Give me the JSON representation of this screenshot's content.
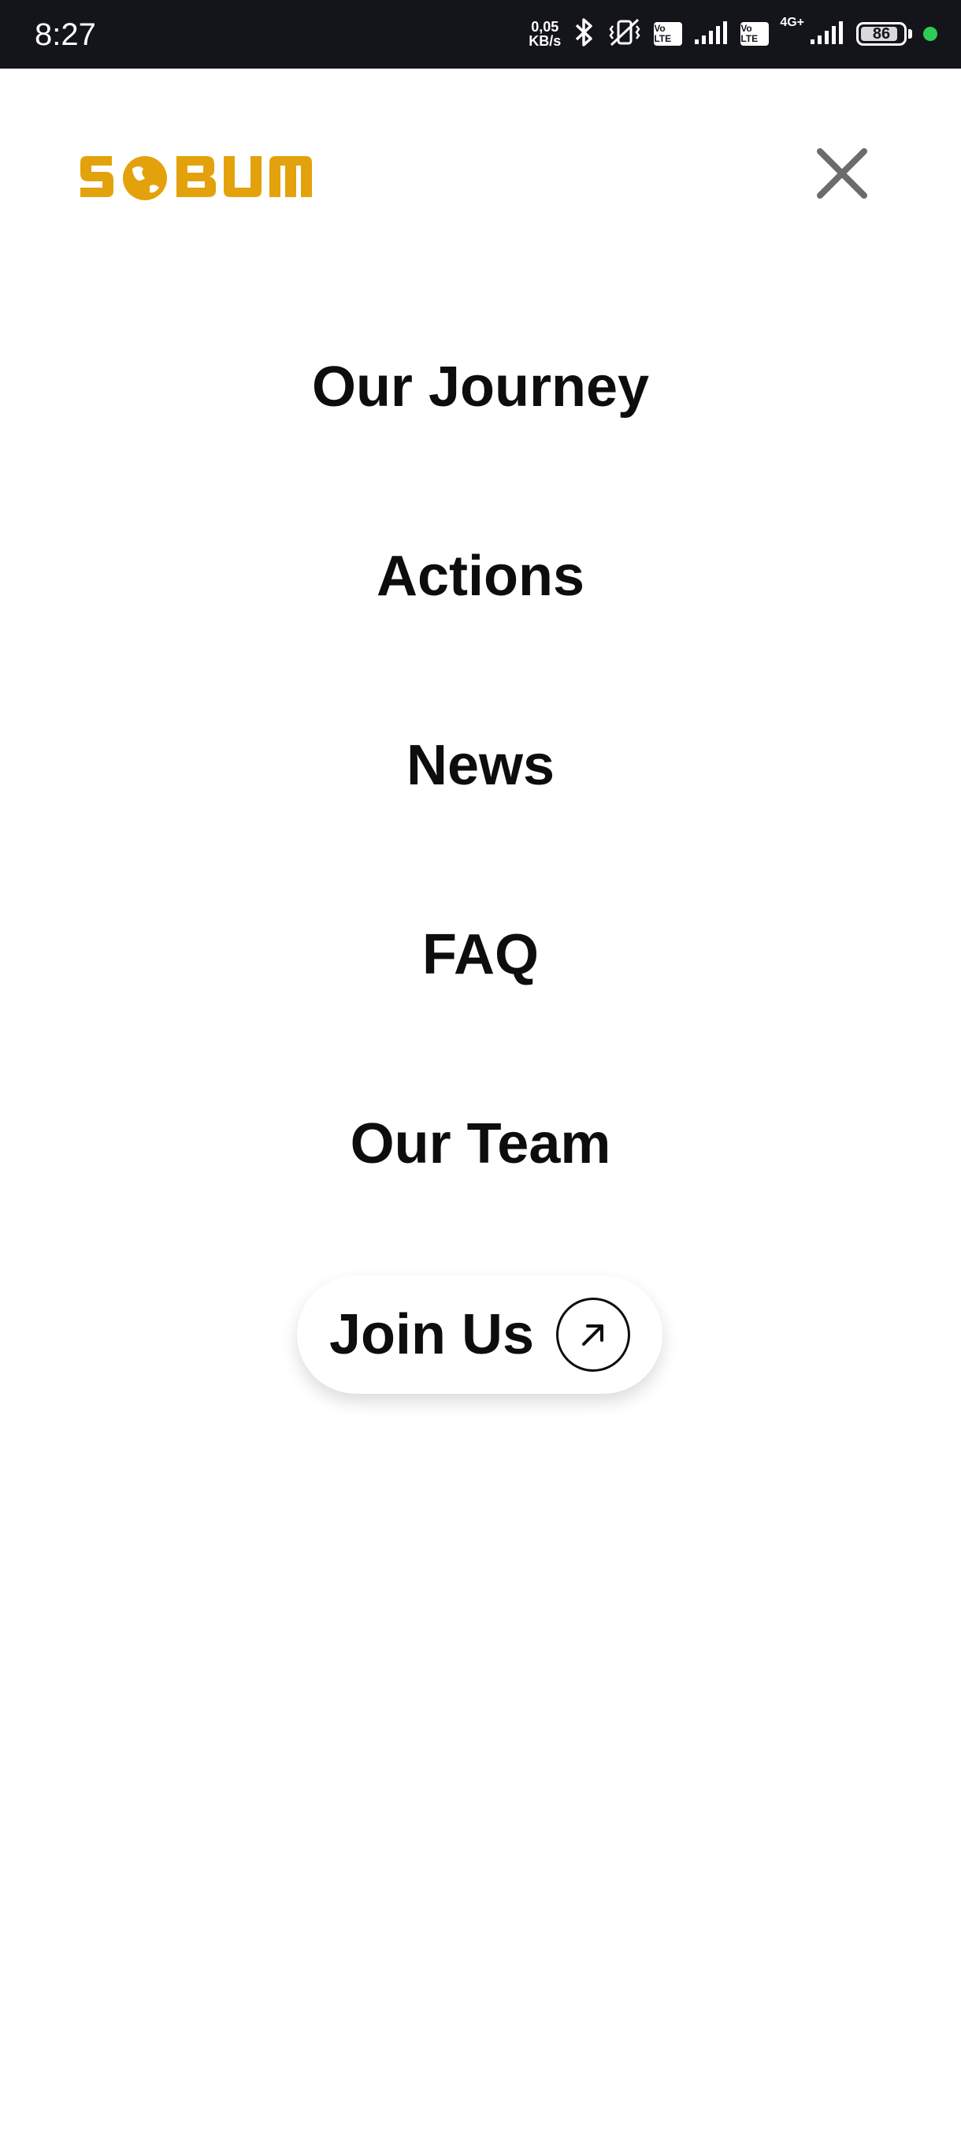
{
  "status_bar": {
    "time": "8:27",
    "net_speed_value": "0,05",
    "net_speed_unit": "KB/s",
    "volte_1": "Vo LTE",
    "volte_2": "Vo LTE",
    "network_type": "4G+",
    "battery_level": "86",
    "icons": [
      "bluetooth-icon",
      "vibrate-mute-icon",
      "signal-icon",
      "battery-icon"
    ],
    "dot_color": "#2ecc55"
  },
  "header": {
    "logo_text": "SOBUM",
    "logo_color": "#e3a20c",
    "close_icon": "close-icon"
  },
  "menu": {
    "items": [
      {
        "label": "Our Journey"
      },
      {
        "label": "Actions"
      },
      {
        "label": "News"
      },
      {
        "label": "FAQ"
      },
      {
        "label": "Our Team"
      }
    ],
    "join_button": {
      "label": "Join Us",
      "icon": "arrow-up-right-icon"
    }
  }
}
